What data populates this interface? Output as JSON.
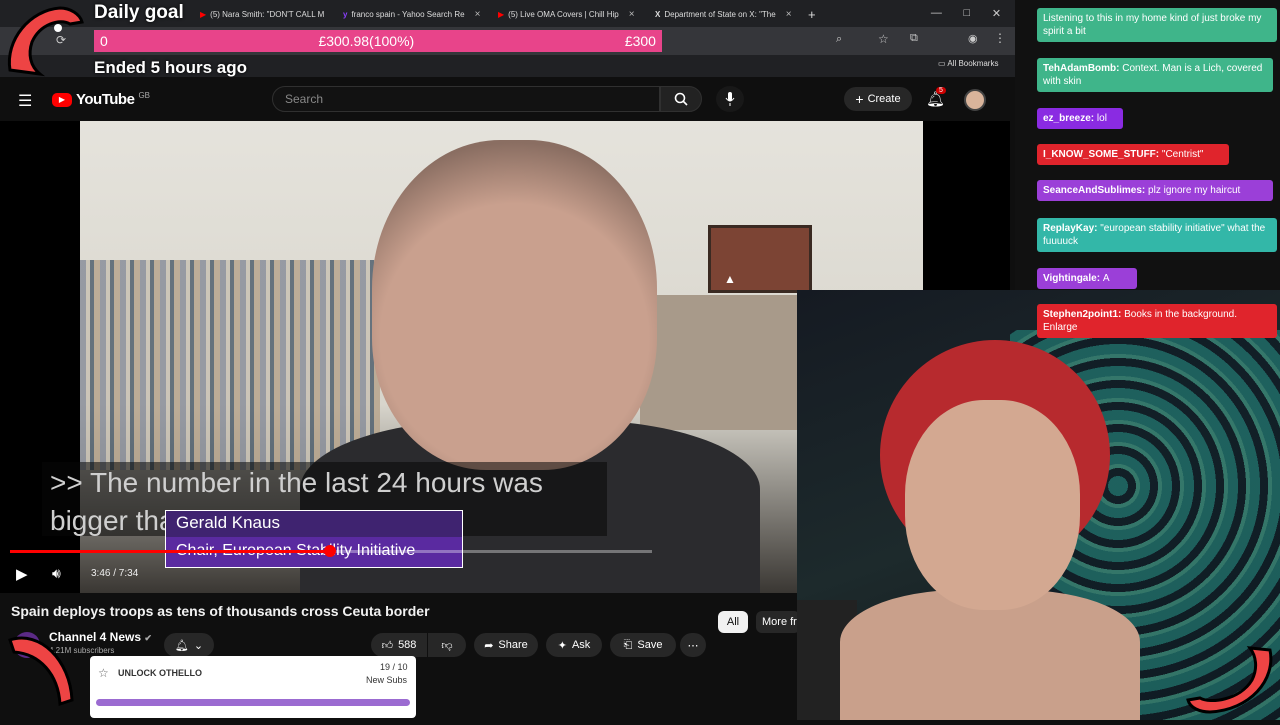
{
  "browser": {
    "tabs": [
      {
        "label": "(5) Nara Smith: \"DON'T CALL M",
        "icon": "youtube-icon"
      },
      {
        "label": "franco spain - Yahoo Search Re",
        "icon": "yahoo-icon"
      },
      {
        "label": "(5) Live OMA Covers | Chill Hip",
        "icon": "youtube-icon"
      },
      {
        "label": "Department of State on X: \"The",
        "icon": "x-icon"
      }
    ],
    "bookmarks_label": "All Bookmarks"
  },
  "goal": {
    "title": "Daily goal",
    "current": "0",
    "amount": "£300.98(100%)",
    "target": "£300",
    "ended": "Ended 5 hours ago",
    "progress_percent": 100
  },
  "youtube": {
    "logo": "YouTube",
    "region": "GB",
    "search_placeholder": "Search",
    "create_label": "Create",
    "notifications": "5"
  },
  "video": {
    "caption": ">> The number in the last 24 hours was bigger than all",
    "lower_third_name": "Gerald Knaus",
    "lower_third_role": "Chair, European Stability Initiative",
    "time": "3:46 / 7:34",
    "progress_fraction": 0.4987,
    "title": "Spain deploys troops as tens of thousands cross Ceuta border",
    "channel": "Channel 4 News",
    "subscribers": "4.21M subscribers",
    "likes": "588",
    "share": "Share",
    "ask": "Ask",
    "save": "Save"
  },
  "chips": {
    "all": "All",
    "more": "More fr"
  },
  "unlock": {
    "label": "UNLOCK OTHELLO",
    "count": "19 / 10",
    "sub": "New Subs"
  },
  "chat": [
    {
      "user": "",
      "text": "Listening to this in my home kind of just broke my spirit a bit",
      "color": "#3fb58a"
    },
    {
      "user": "TehAdamBomb:",
      "text": "Context. Man is a Lich, covered with skin",
      "color": "#3fb58a"
    },
    {
      "user": "ez_breeze:",
      "text": "lol",
      "color": "#8a2be2"
    },
    {
      "user": "I_KNOW_SOME_STUFF:",
      "text": "\"Centrist\"",
      "color": "#e0242c"
    },
    {
      "user": "SeanceAndSublimes:",
      "text": "plz ignore my haircut",
      "color": "#9b3fd8"
    },
    {
      "user": "ReplayKay:",
      "text": "\"european stability initiative\" what the fuuuuck",
      "color": "#33b7a8"
    },
    {
      "user": "Vightingale:",
      "text": "A",
      "color": "#9b3fd8"
    },
    {
      "user": "Stephen2point1:",
      "text": "Books in the background. Enlarge",
      "color": "#e0242c"
    }
  ]
}
